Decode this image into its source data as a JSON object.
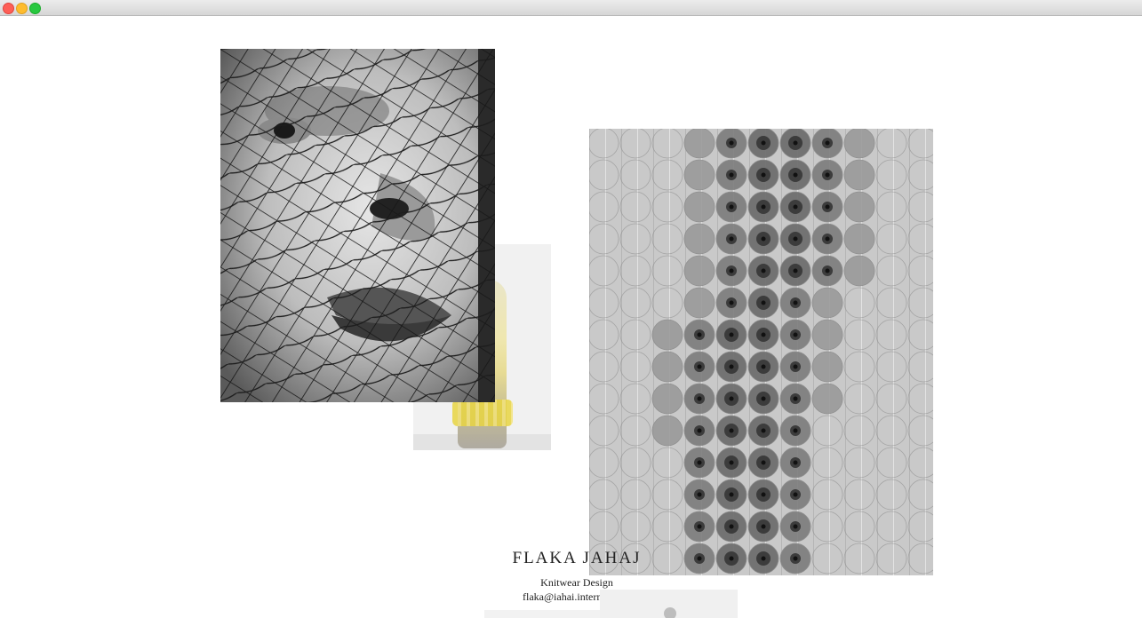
{
  "window": {
    "buttons": [
      "close",
      "minimize",
      "zoom"
    ]
  },
  "site": {
    "name": "FLAKA JAHAJ",
    "tagline": "Knitwear Design",
    "email": "flaka@iahai.international"
  },
  "images": {
    "face": "portrait-behind-net-photo",
    "figure": "knit-costume-figure-photo",
    "knit": "knit-circle-grid-artwork",
    "peek_left": "partial-image",
    "peek_right": "partial-image"
  },
  "colors": {
    "background": "#ffffff",
    "text": "#222222",
    "close": "#fe5f57",
    "minimize": "#febc2e",
    "zoom": "#28c840"
  }
}
